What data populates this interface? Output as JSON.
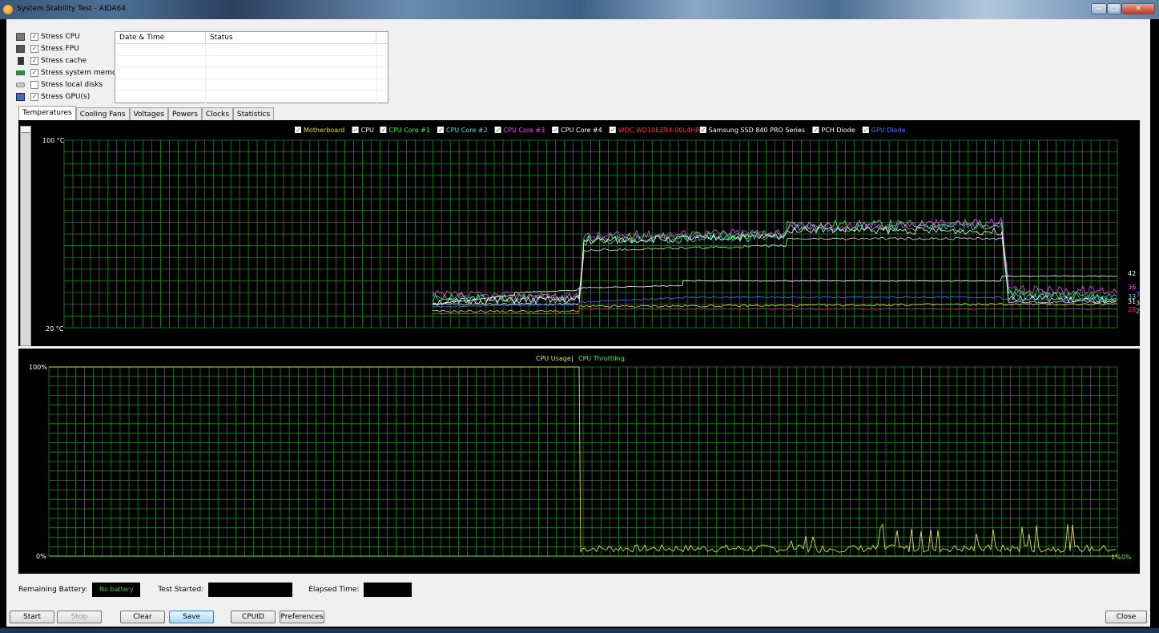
{
  "window": {
    "title": "System Stability Test - AIDA64",
    "buttons": {
      "minimize": "—",
      "maximize": "□",
      "close": "✕"
    }
  },
  "stress": [
    {
      "label": "Stress CPU",
      "checked": true,
      "icon": "cpu-icon"
    },
    {
      "label": "Stress FPU",
      "checked": true,
      "icon": "fpu-icon"
    },
    {
      "label": "Stress cache",
      "checked": true,
      "icon": "cache-icon"
    },
    {
      "label": "Stress system memory",
      "checked": true,
      "icon": "memory-icon"
    },
    {
      "label": "Stress local disks",
      "checked": false,
      "icon": "disk-icon"
    },
    {
      "label": "Stress GPU(s)",
      "checked": true,
      "icon": "gpu-icon"
    }
  ],
  "log": {
    "col_datetime": "Date & Time",
    "col_status": "Status"
  },
  "tabs": [
    "Temperatures",
    "Cooling Fans",
    "Voltages",
    "Powers",
    "Clocks",
    "Statistics"
  ],
  "active_tab": "Temperatures",
  "temp_graph": {
    "legend": [
      {
        "name": "Motherboard",
        "color": "#e0e030"
      },
      {
        "name": "CPU",
        "color": "#ffffff"
      },
      {
        "name": "CPU Core #1",
        "color": "#3cff3c"
      },
      {
        "name": "CPU Core #2",
        "color": "#40e0e0"
      },
      {
        "name": "CPU Core #3",
        "color": "#ff40ff"
      },
      {
        "name": "CPU Core #4",
        "color": "#ffffff"
      },
      {
        "name": "WDC WD10EZRX-00L4HB0",
        "color": "#ff3030"
      },
      {
        "name": "Samsung SSD 840 PRO Series",
        "color": "#ffffff"
      },
      {
        "name": "PCH Diode",
        "color": "#ffffff"
      },
      {
        "name": "GPU Diode",
        "color": "#3a7fff"
      }
    ],
    "y_max_label": "100 °C",
    "y_min_label": "20 °C",
    "end_values": [
      {
        "value": "42",
        "color": "#ffffff"
      },
      {
        "value": "36",
        "color": "#ff40ff"
      },
      {
        "value": "32",
        "color": "#3a7fff"
      },
      {
        "value": "33",
        "color": "#40e0e0"
      },
      {
        "value": "31",
        "color": "#ffffff"
      },
      {
        "value": "30",
        "color": "#e0e030"
      },
      {
        "value": "28",
        "color": "#ff3030"
      },
      {
        "value": "27",
        "color": "#40e0e0"
      }
    ]
  },
  "usage_graph": {
    "legend_usage": "CPU Usage",
    "legend_sep": "|",
    "legend_throttle": "CPU Throttling",
    "y_max_label": "100%",
    "y_min_label": "0%",
    "end_usage": "1%",
    "end_throttle": "0%"
  },
  "chart_data": [
    {
      "type": "line",
      "title": "",
      "ylabel": "°C",
      "ylim": [
        20,
        100
      ],
      "series": [
        {
          "name": "Motherboard",
          "last": 30
        },
        {
          "name": "CPU",
          "last": 31
        },
        {
          "name": "CPU Core #1",
          "last": 33
        },
        {
          "name": "CPU Core #2",
          "last": 27
        },
        {
          "name": "CPU Core #3",
          "last": 36
        },
        {
          "name": "CPU Core #4",
          "last": 31
        },
        {
          "name": "WDC WD10EZRX-00L4HB0",
          "last": 28
        },
        {
          "name": "Samsung SSD 840 PRO Series",
          "last": 42
        },
        {
          "name": "PCH Diode",
          "last": 42
        },
        {
          "name": "GPU Diode",
          "last": 32
        }
      ]
    },
    {
      "type": "line",
      "ylim": [
        0,
        100
      ],
      "series": [
        {
          "name": "CPU Usage",
          "last": 1
        },
        {
          "name": "CPU Throttling",
          "last": 0
        }
      ]
    }
  ],
  "status": {
    "battery_label": "Remaining Battery:",
    "battery_value": "No battery",
    "started_label": "Test Started:",
    "elapsed_label": "Elapsed Time:"
  },
  "buttons": {
    "start": "Start",
    "stop": "Stop",
    "clear": "Clear",
    "save": "Save",
    "cpuid": "CPUID",
    "preferences": "Preferences",
    "close": "Close"
  }
}
